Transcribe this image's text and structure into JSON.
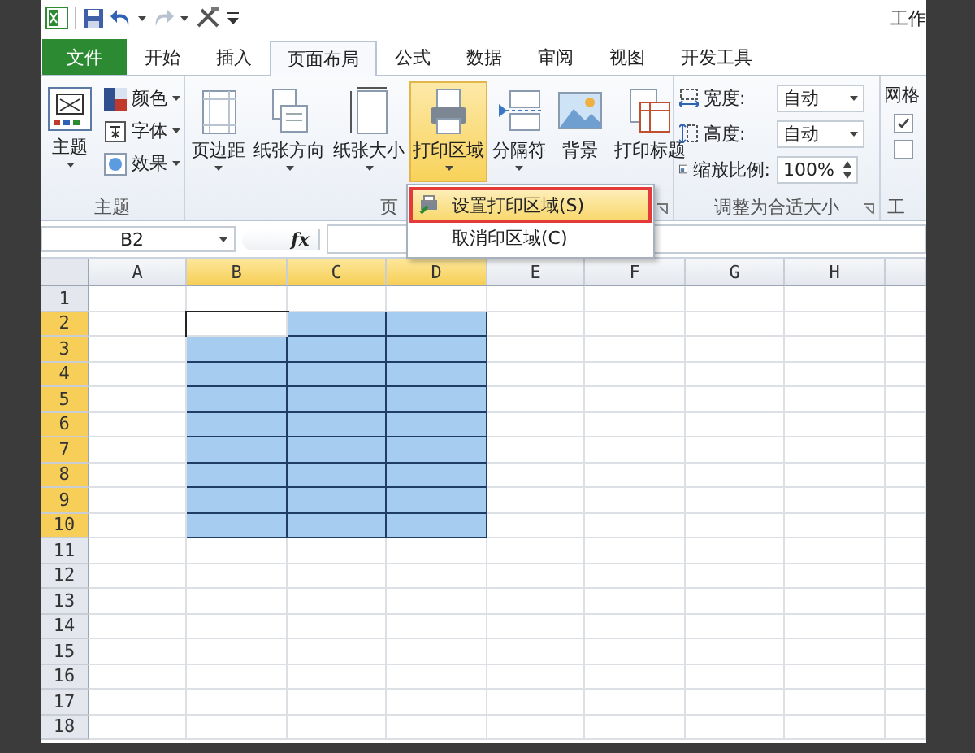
{
  "window": {
    "title": "工作"
  },
  "tabs": [
    {
      "label": "文件",
      "kind": "file",
      "selected": false
    },
    {
      "label": "开始",
      "kind": "tab",
      "selected": false
    },
    {
      "label": "插入",
      "kind": "tab",
      "selected": false
    },
    {
      "label": "页面布局",
      "kind": "tab",
      "selected": true
    },
    {
      "label": "公式",
      "kind": "tab",
      "selected": false
    },
    {
      "label": "数据",
      "kind": "tab",
      "selected": false
    },
    {
      "label": "审阅",
      "kind": "tab",
      "selected": false
    },
    {
      "label": "视图",
      "kind": "tab",
      "selected": false
    },
    {
      "label": "开发工具",
      "kind": "tab",
      "selected": false
    }
  ],
  "theme_group": {
    "label": "主题",
    "button": "主题",
    "items": [
      {
        "label": "颜色"
      },
      {
        "label": "字体"
      },
      {
        "label": "效果"
      }
    ]
  },
  "page_setup_group": {
    "label": "页",
    "buttons": [
      {
        "label": "页边距",
        "selected": false
      },
      {
        "label": "纸张方向",
        "selected": false
      },
      {
        "label": "纸张大小",
        "selected": false
      },
      {
        "label": "打印区域",
        "selected": true
      },
      {
        "label": "分隔符",
        "selected": false
      },
      {
        "label": "背景",
        "selected": false
      },
      {
        "label": "打印标题",
        "selected": false
      }
    ]
  },
  "fit_group": {
    "label": "调整为合适大小",
    "fields": [
      {
        "label": "宽度:",
        "value": "自动",
        "kind": "dropdown"
      },
      {
        "label": "高度:",
        "value": "自动",
        "kind": "dropdown"
      },
      {
        "label": "缩放比例:",
        "value": "100%",
        "kind": "spinner"
      }
    ]
  },
  "gridlines_group": {
    "label": "网格",
    "checks": [
      {
        "checked": true
      },
      {
        "checked": false
      }
    ],
    "footer": "工"
  },
  "print_area_menu": {
    "items": [
      {
        "label": "设置打印区域(S)",
        "selected": true
      },
      {
        "label": "取消印区域(C)",
        "selected": false
      }
    ]
  },
  "formula_bar": {
    "name_box": "B2",
    "fx": "fx"
  },
  "sheet": {
    "columns": [
      {
        "label": "A",
        "selected": false
      },
      {
        "label": "B",
        "selected": true
      },
      {
        "label": "C",
        "selected": true
      },
      {
        "label": "D",
        "selected": true
      },
      {
        "label": "E",
        "selected": false
      },
      {
        "label": "F",
        "selected": false
      },
      {
        "label": "G",
        "selected": false
      },
      {
        "label": "H",
        "selected": false
      }
    ],
    "rows": [
      {
        "label": "1",
        "selected": false
      },
      {
        "label": "2",
        "selected": true
      },
      {
        "label": "3",
        "selected": true
      },
      {
        "label": "4",
        "selected": true
      },
      {
        "label": "5",
        "selected": true
      },
      {
        "label": "6",
        "selected": true
      },
      {
        "label": "7",
        "selected": true
      },
      {
        "label": "8",
        "selected": true
      },
      {
        "label": "9",
        "selected": true
      },
      {
        "label": "10",
        "selected": true
      },
      {
        "label": "11",
        "selected": false
      },
      {
        "label": "12",
        "selected": false
      },
      {
        "label": "13",
        "selected": false
      },
      {
        "label": "14",
        "selected": false
      },
      {
        "label": "15",
        "selected": false
      },
      {
        "label": "16",
        "selected": false
      },
      {
        "label": "17",
        "selected": false
      },
      {
        "label": "18",
        "selected": false
      }
    ]
  }
}
